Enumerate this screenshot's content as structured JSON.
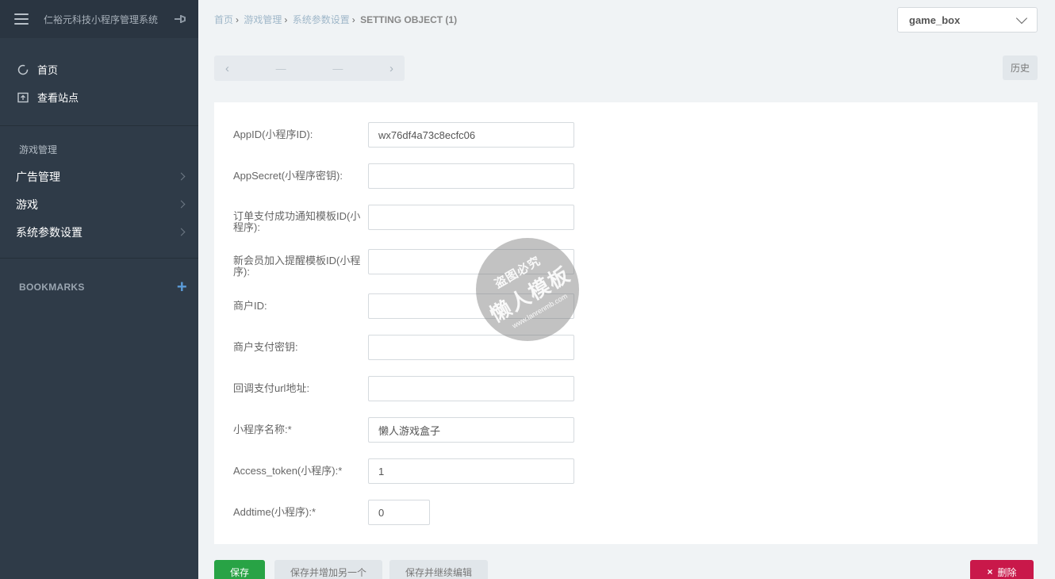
{
  "sidebar": {
    "title": "仁裕元科技小程序管理系统",
    "top_links": [
      {
        "label": "首页",
        "icon": "circle-icon"
      },
      {
        "label": "查看站点",
        "icon": "site-icon"
      }
    ],
    "section_caption": "游戏管理",
    "items": [
      {
        "label": "广告管理"
      },
      {
        "label": "游戏"
      },
      {
        "label": "系统参数设置"
      }
    ],
    "bookmarks_label": "BOOKMARKS",
    "bookmarks_add": "+"
  },
  "breadcrumb": {
    "items": [
      "首页",
      "游戏管理",
      "系统参数设置"
    ],
    "current": "SETTING OBJECT (1)"
  },
  "site_select": {
    "value": "game_box"
  },
  "pager": {
    "prev": "‹",
    "next": "›",
    "dash1": "—",
    "dash2": "—"
  },
  "history_label": "历史",
  "form": {
    "fields": [
      {
        "label": "AppID(小程序ID):",
        "value": "wx76df4a73c8ecfc06"
      },
      {
        "label": "AppSecret(小程序密钥):",
        "value": ""
      },
      {
        "label": "订单支付成功通知模板ID(小程序):",
        "value": ""
      },
      {
        "label": "新会员加入提醒模板ID(小程序):",
        "value": ""
      },
      {
        "label": "商户ID:",
        "value": ""
      },
      {
        "label": "商户支付密钥:",
        "value": ""
      },
      {
        "label": "回调支付url地址:",
        "value": ""
      },
      {
        "label": "小程序名称:*",
        "value": "懒人游戏盒子"
      },
      {
        "label": "Access_token(小程序):*",
        "value": "1"
      },
      {
        "label": "Addtime(小程序):*",
        "value": "0"
      }
    ]
  },
  "actions": {
    "save": "保存",
    "save_add": "保存并增加另一个",
    "save_continue": "保存并继续编辑",
    "delete": "删除",
    "delete_icon": "×"
  },
  "watermark": {
    "line1": "盗图必究",
    "line2": "懒人模板",
    "line3": "www.lanrenmb.com"
  },
  "colors": {
    "sidebar_bg": "#2f3b48",
    "save": "#28a345",
    "delete": "#c9184a",
    "accent": "#5b9bd8"
  }
}
